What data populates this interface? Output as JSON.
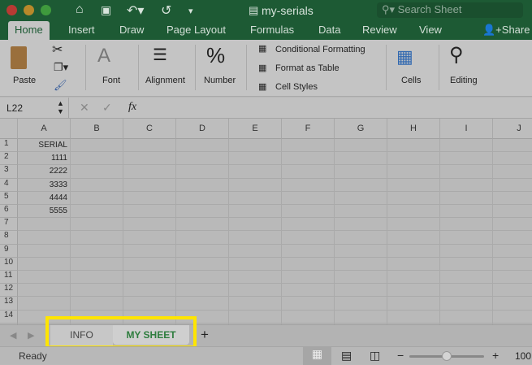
{
  "window": {
    "title": "my-serials",
    "search_placeholder": "Search Sheet",
    "share_label": "Share"
  },
  "tabs": [
    "Home",
    "Insert",
    "Draw",
    "Page Layout",
    "Formulas",
    "Data",
    "Review",
    "View"
  ],
  "active_tab": "Home",
  "ribbon": {
    "paste": "Paste",
    "font": "Font",
    "alignment": "Alignment",
    "number": "Number",
    "number_icon": "%",
    "conditional_formatting": "Conditional Formatting",
    "format_as_table": "Format as Table",
    "cell_styles": "Cell Styles",
    "cells": "Cells",
    "editing": "Editing"
  },
  "formula_bar": {
    "name_box": "L22",
    "fx": "fx",
    "value": ""
  },
  "columns": [
    "A",
    "B",
    "C",
    "D",
    "E",
    "F",
    "G",
    "H",
    "I",
    "J"
  ],
  "rows": [
    "1",
    "2",
    "3",
    "4",
    "5",
    "6",
    "7",
    "8",
    "9",
    "10",
    "11",
    "12",
    "13",
    "14"
  ],
  "column_a": [
    "SERIAL",
    "1111",
    "2222",
    "3333",
    "4444",
    "5555"
  ],
  "sheets": [
    {
      "label": "INFO",
      "active": false
    },
    {
      "label": "MY SHEET",
      "active": true
    }
  ],
  "add_sheet": "+",
  "status": {
    "text": "Ready",
    "zoom": "100",
    "zoom_level": 0.5
  },
  "colors": {
    "titlebar": "#1d5a34",
    "highlight": "#ffe500",
    "active_sheet": "#2e7d3e"
  }
}
